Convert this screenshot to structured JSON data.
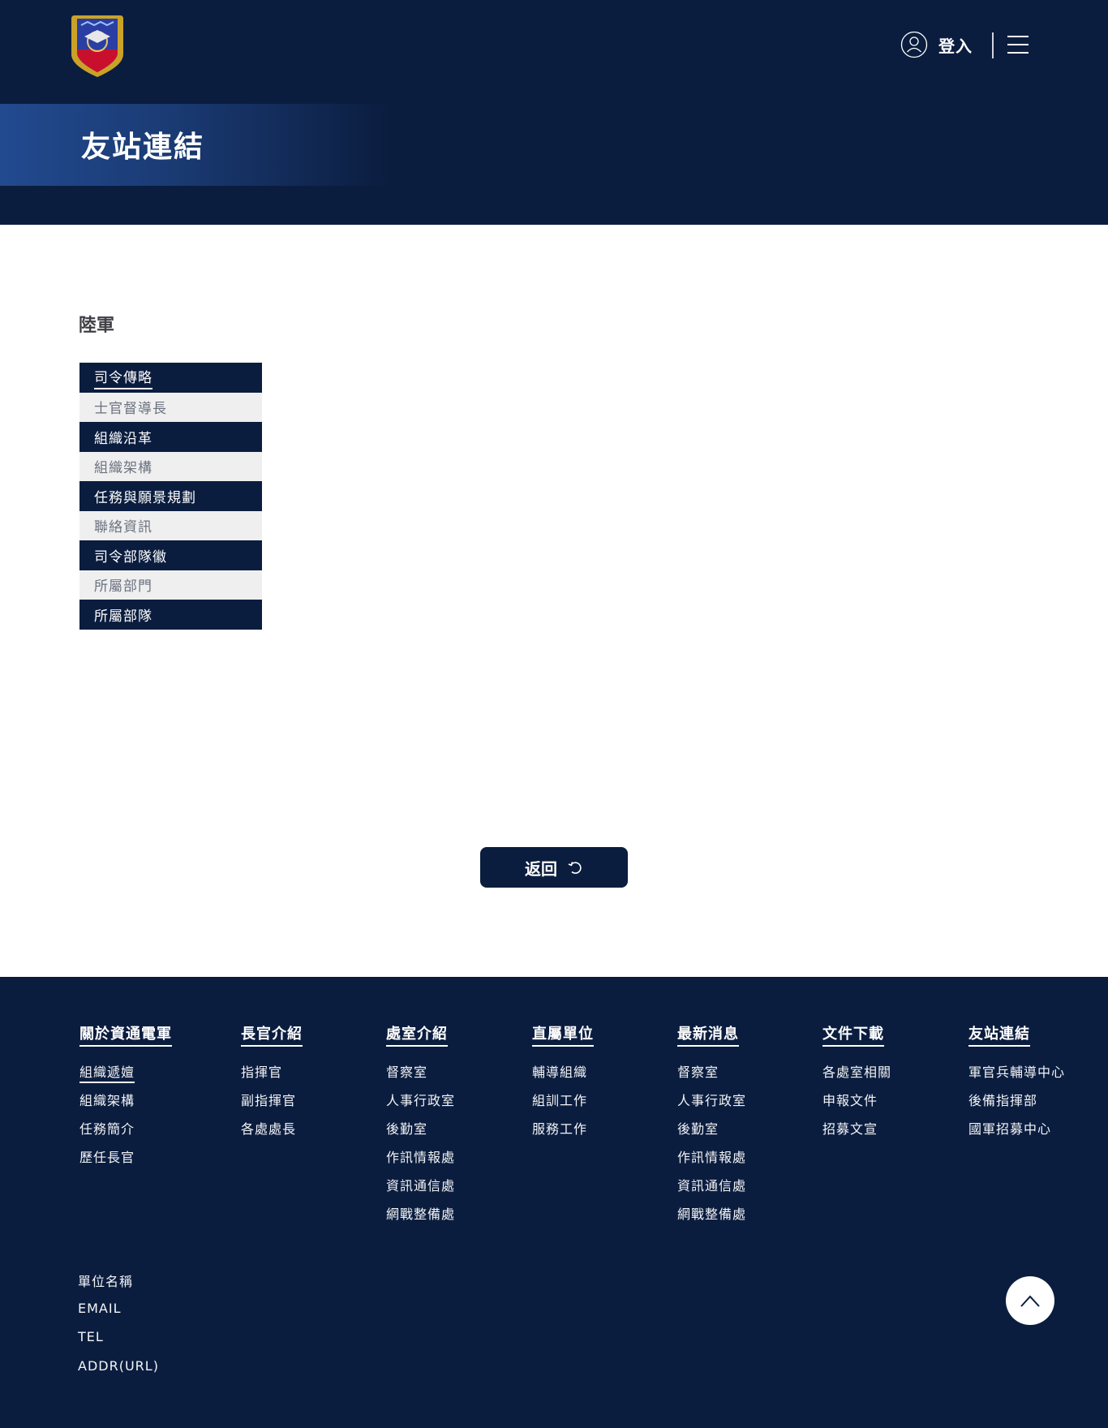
{
  "header": {
    "login_label": "登入",
    "page_title": "友站連結"
  },
  "main": {
    "section_title": "陸軍",
    "links": [
      {
        "label": "司令傳略",
        "style": "dark"
      },
      {
        "label": "士官督導長",
        "style": "light"
      },
      {
        "label": "組織沿革",
        "style": "dark"
      },
      {
        "label": "組織架構",
        "style": "light"
      },
      {
        "label": "任務與願景規劃",
        "style": "dark"
      },
      {
        "label": "聯絡資訊",
        "style": "light"
      },
      {
        "label": "司令部隊徽",
        "style": "dark"
      },
      {
        "label": "所屬部門",
        "style": "light"
      },
      {
        "label": "所屬部隊",
        "style": "dark"
      }
    ],
    "back_label": "返回"
  },
  "footer": {
    "columns": [
      {
        "title": "關於資通電軍",
        "items": [
          "組織遞嬗",
          "組織架構",
          "任務簡介",
          "歷任長官"
        ]
      },
      {
        "title": "長官介紹",
        "items": [
          "指揮官",
          "副指揮官",
          "各處處長"
        ]
      },
      {
        "title": "處室介紹",
        "items": [
          "督察室",
          "人事行政室",
          "後勤室",
          "作訊情報處",
          "資訊通信處",
          "網戰整備處"
        ]
      },
      {
        "title": "直屬單位",
        "items": [
          "輔導組織",
          "組訓工作",
          "服務工作"
        ]
      },
      {
        "title": "最新消息",
        "items": [
          "督察室",
          "人事行政室",
          "後勤室",
          "作訊情報處",
          "資訊通信處",
          "網戰整備處"
        ]
      },
      {
        "title": "文件下載",
        "items": [
          "各處室相關",
          "申報文件",
          "招募文宣"
        ]
      },
      {
        "title": "友站連結",
        "items": [
          "軍官兵輔導中心",
          "後備指揮部",
          "國軍招募中心"
        ]
      }
    ],
    "contact": {
      "unit_name": "單位名稱",
      "email": "EMAIL",
      "tel": "TEL",
      "addr": "ADDR(URL)"
    }
  },
  "icons": {
    "logo": "army-emblem-logo",
    "login": "user-icon",
    "menu": "hamburger-menu-icon",
    "back": "undo-arrow-icon",
    "to_top": "chevron-up-icon"
  },
  "colors": {
    "navy": "#0b1d3f",
    "banner_blue": "#224a8f",
    "light_row": "#efefef",
    "white": "#ffffff"
  }
}
